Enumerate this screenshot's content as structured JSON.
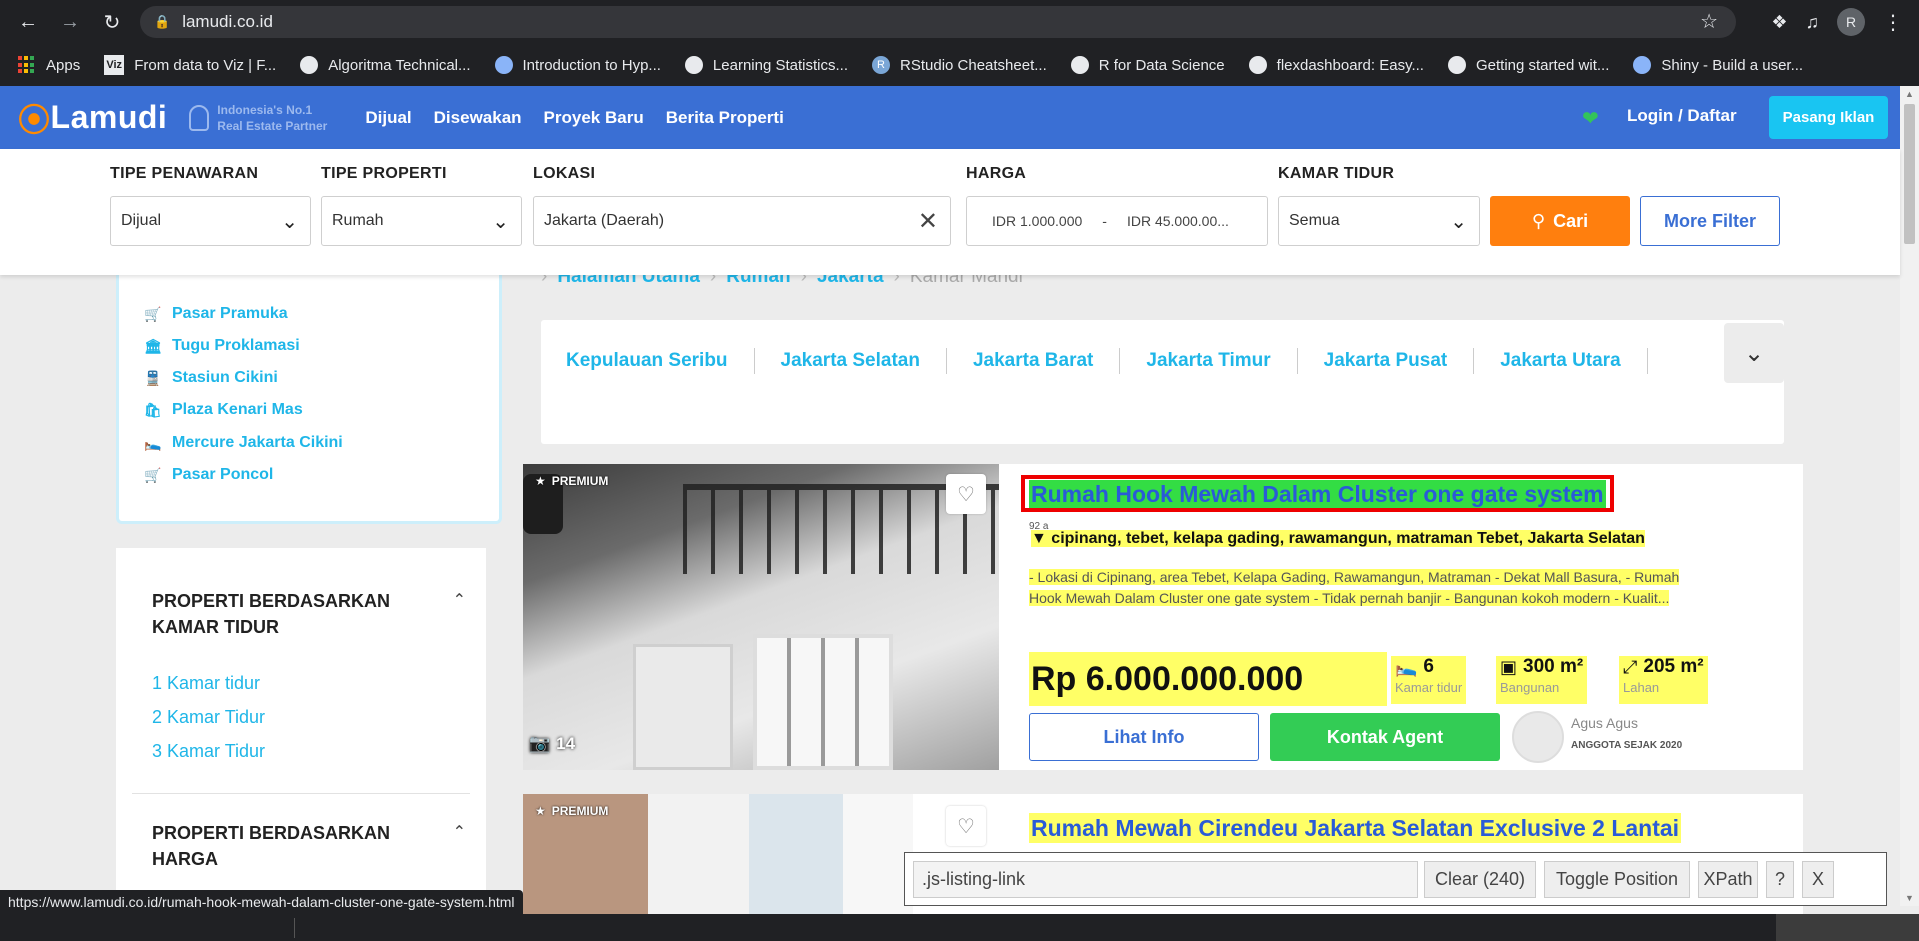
{
  "browser": {
    "url": "lamudi.co.id",
    "profile_initial": "R",
    "status_url": "https://www.lamudi.co.id/rumah-hook-mewah-dalam-cluster-one-gate-system.html"
  },
  "bookmarks": [
    {
      "label": "Apps"
    },
    {
      "label": "From data to Viz | F..."
    },
    {
      "label": "Algoritma Technical..."
    },
    {
      "label": "Introduction to Hyp..."
    },
    {
      "label": "Learning Statistics..."
    },
    {
      "label": "RStudio Cheatsheet..."
    },
    {
      "label": "R for Data Science"
    },
    {
      "label": "flexdashboard: Easy..."
    },
    {
      "label": "Getting started wit..."
    },
    {
      "label": "Shiny - Build a user..."
    }
  ],
  "header": {
    "logo": "Lamudi",
    "tagline_line1": "Indonesia's No.1",
    "tagline_line2": "Real Estate Partner",
    "nav": [
      "Dijual",
      "Disewakan",
      "Proyek Baru",
      "Berita Properti"
    ],
    "login": "Login / Daftar",
    "cta": "Pasang Iklan"
  },
  "filters": {
    "offer_label": "TIPE PENAWARAN",
    "offer_value": "Dijual",
    "property_label": "TIPE PROPERTI",
    "property_value": "Rumah",
    "location_label": "LOKASI",
    "location_value": "Jakarta (Daerah)",
    "price_label": "HARGA",
    "price_min": "IDR 1.000.000",
    "price_sep": "-",
    "price_max": "IDR 45.000.00...",
    "bedroom_label": "KAMAR TIDUR",
    "bedroom_value": "Semua",
    "search_btn": "Cari",
    "more_btn": "More Filter"
  },
  "poi": [
    "Pasar Pramuka",
    "Tugu Proklamasi",
    "Stasiun Cikini",
    "Plaza Kenari Mas",
    "Mercure Jakarta Cikini",
    "Pasar Poncol"
  ],
  "sidebar": {
    "section1_title": "PROPERTI BERDASARKAN KAMAR TIDUR",
    "section1_links": [
      "1 Kamar tidur",
      "2 Kamar Tidur",
      "3 Kamar Tidur"
    ],
    "section2_title": "PROPERTI BERDASARKAN HARGA"
  },
  "breadcrumb": [
    "Halaman Utama",
    "Rumah",
    "Jakarta",
    "Kamar Mandi"
  ],
  "regions": [
    "Kepulauan Seribu",
    "Jakarta Selatan",
    "Jakarta Barat",
    "Jakarta Timur",
    "Jakarta Pusat",
    "Jakarta Utara"
  ],
  "listings": [
    {
      "badge": "PREMIUM",
      "photos": "14",
      "title": "Rumah Hook Mewah Dalam Cluster one gate system",
      "tag": "92 a",
      "location": "cipinang, tebet, kelapa gading, rawamangun, matraman Tebet, Jakarta Selatan",
      "desc_line1": "- Lokasi di Cipinang, area Tebet, Kelapa Gading, Rawamangun, Matraman - Dekat Mall Basura,  - Rumah",
      "desc_line2": "Hook Mewah Dalam Cluster one gate system - Tidak pernah banjir - Bangunan kokoh modern - Kualit...",
      "price": "Rp 6.000.000.000",
      "bedrooms": "6",
      "bedrooms_label": "Kamar tidur",
      "building": "300 m²",
      "building_label": "Bangunan",
      "land": "205 m²",
      "land_label": "Lahan",
      "info_btn": "Lihat Info",
      "agent_btn": "Kontak Agent",
      "agent_name": "Agus Agus",
      "agent_since": "ANGGOTA SEJAK 2020"
    },
    {
      "badge": "PREMIUM",
      "title": "Rumah Mewah Cirendeu Jakarta Selatan Exclusive 2 Lantai"
    }
  ],
  "selector_gadget": {
    "selector": ".js-listing-link",
    "clear": "Clear (240)",
    "toggle": "Toggle Position",
    "xpath": "XPath",
    "help": "?",
    "close": "X"
  }
}
